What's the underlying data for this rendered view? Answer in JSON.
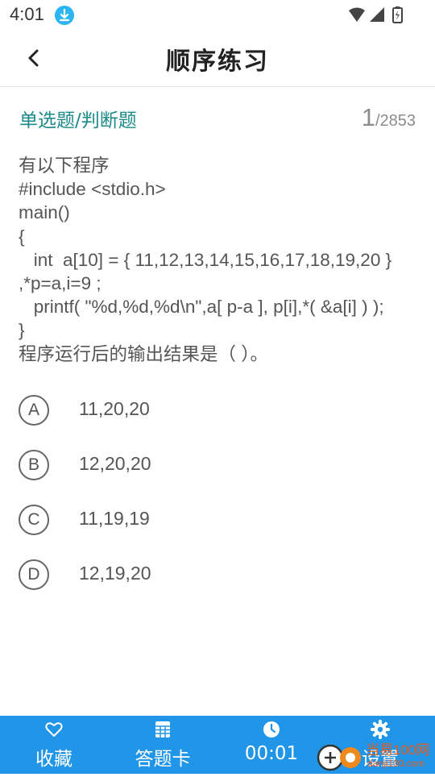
{
  "status_bar": {
    "time": "4:01",
    "icons": [
      "download-icon",
      "wifi-icon",
      "signal-icon",
      "battery-icon"
    ]
  },
  "header": {
    "title": "顺序练习",
    "back_icon": "chevron-left-icon"
  },
  "question": {
    "type_label": "单选题/判断题",
    "current": "1",
    "total": "/2853",
    "lines": [
      "有以下程序",
      "#include <stdio.h>",
      "main()",
      "{",
      "   int  a[10] = { 11,12,13,14,15,16,17,18,19,20 }",
      ",*p=a,i=9 ;",
      "   printf( \"%d,%d,%d\\n\",a[ p-a ], p[i],*( &a[i] ) );",
      "}",
      "程序运行后的输出结果是（ ）。"
    ]
  },
  "options": [
    {
      "letter": "A",
      "text": "11,20,20"
    },
    {
      "letter": "B",
      "text": "12,20,20"
    },
    {
      "letter": "C",
      "text": "11,19,19"
    },
    {
      "letter": "D",
      "text": "12,19,20"
    }
  ],
  "bottom_bar": {
    "tabs": [
      {
        "label": "收藏",
        "icon": "heart-icon"
      },
      {
        "label": "答题卡",
        "icon": "grid-icon"
      },
      {
        "label": "00:01",
        "icon": "clock-icon"
      },
      {
        "label": "设置",
        "icon": "gear-icon"
      }
    ]
  },
  "watermark": {
    "text": "当易100网",
    "sub": "danji100.com"
  },
  "colors": {
    "accent": "#2196e8",
    "type_label": "#1d8a8a",
    "text": "#555555",
    "progress": "#8c8c8c"
  }
}
